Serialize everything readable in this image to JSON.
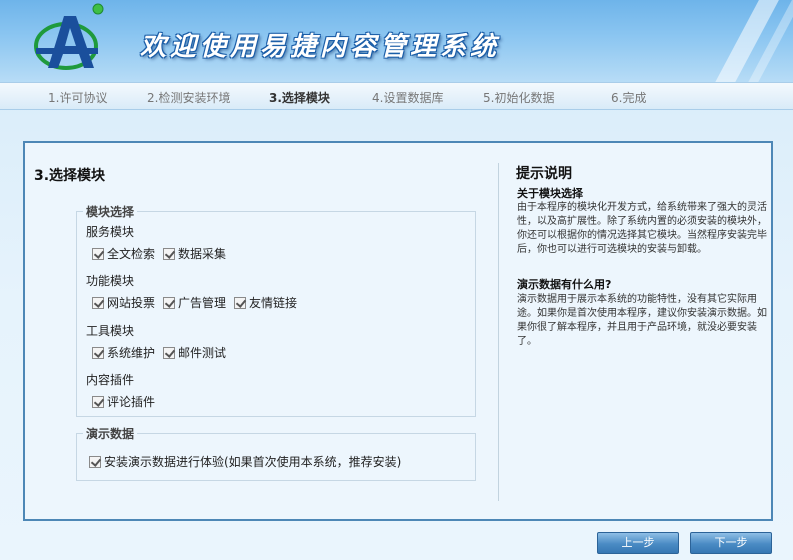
{
  "header": {
    "app_title": "欢迎使用易捷内容管理系统",
    "logo_letter": "A"
  },
  "steps": [
    {
      "label": "1.许可协议",
      "active": false
    },
    {
      "label": "2.检测安装环境",
      "active": false
    },
    {
      "label": "3.选择模块",
      "active": true
    },
    {
      "label": "4.设置数据库",
      "active": false
    },
    {
      "label": "5.初始化数据",
      "active": false
    },
    {
      "label": "6.完成",
      "active": false
    }
  ],
  "main": {
    "section_title": "3.选择模块",
    "modules": {
      "legend": "模块选择",
      "groups": [
        {
          "label": "服务模块",
          "items": [
            {
              "label": "全文检索",
              "checked": true
            },
            {
              "label": "数据采集",
              "checked": true
            }
          ]
        },
        {
          "label": "功能模块",
          "items": [
            {
              "label": "网站投票",
              "checked": true
            },
            {
              "label": "广告管理",
              "checked": true
            },
            {
              "label": "友情链接",
              "checked": true
            }
          ]
        },
        {
          "label": "工具模块",
          "items": [
            {
              "label": "系统维护",
              "checked": true
            },
            {
              "label": "邮件测试",
              "checked": true
            }
          ]
        },
        {
          "label": "内容插件",
          "items": [
            {
              "label": "评论插件",
              "checked": true
            }
          ]
        }
      ]
    },
    "demo": {
      "legend": "演示数据",
      "option_label": "安装演示数据进行体验(如果首次使用本系统，推荐安装)",
      "checked": true
    }
  },
  "tips": {
    "title": "提示说明",
    "sections": [
      {
        "heading": "关于模块选择",
        "text": "由于本程序的模块化开发方式，给系统带来了强大的灵活性，以及高扩展性。除了系统内置的必须安装的模块外，你还可以根据你的情况选择其它模块。当然程序安装完毕后，你也可以进行可选模块的安装与卸载。"
      },
      {
        "heading": "演示数据有什么用?",
        "text": "演示数据用于展示本系统的功能特性，没有其它实际用途。如果你是首次使用本程序，建议你安装演示数据。如果你很了解本程序，并且用于产品环境，就没必要安装了。"
      }
    ]
  },
  "buttons": {
    "prev_label": "上一步",
    "next_label": "下一步"
  }
}
